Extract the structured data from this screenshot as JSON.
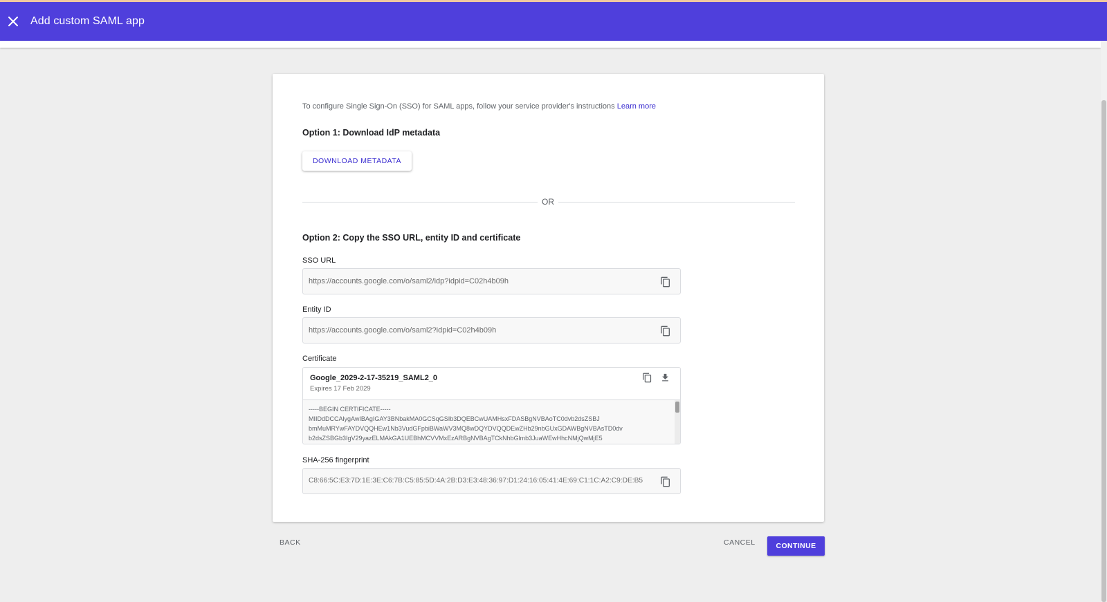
{
  "appbar": {
    "title": "Add custom SAML app"
  },
  "intro": {
    "text": "To configure Single Sign-On (SSO) for SAML apps, follow your service provider's instructions",
    "link": "Learn more"
  },
  "option1": {
    "heading": "Option 1: Download IdP metadata",
    "button": "DOWNLOAD METADATA"
  },
  "separator": "OR",
  "option2": {
    "heading": "Option 2: Copy the SSO URL, entity ID and certificate",
    "sso_url": {
      "label": "SSO URL",
      "value": "https://accounts.google.com/o/saml2/idp?idpid=C02h4b09h"
    },
    "entity_id": {
      "label": "Entity ID",
      "value": "https://accounts.google.com/o/saml2?idpid=C02h4b09h"
    },
    "certificate": {
      "label": "Certificate",
      "name": "Google_2029-2-17-35219_SAML2_0",
      "expires": "Expires 17 Feb 2029",
      "lines": [
        "-----BEGIN CERTIFICATE-----",
        "MIIDdDCCAlygAwIBAgIGAY3BNbakMA0GCSqGSIb3DQEBCwUAMHsxFDASBgNVBAoTC0dvb2dsZSBJ",
        "bmMuMRYwFAYDVQQHEw1Nb3VudGFpbiBWaWV3MQ8wDQYDVQQDEwZHb29nbGUxGDAWBgNVBAsTD0dv",
        "b2dsZSBGb3IgV29yazELMAkGA1UEBhMCVVMxEzARBgNVBAgTCkNhbGlmb3JuaWEwHhcNMjQwMjE5"
      ]
    },
    "fingerprint": {
      "label": "SHA-256 fingerprint",
      "value": "C8:66:5C:E3:7D:1E:3E:C6:7B:C5:85:5D:4A:2B:D3:E3:48:36:97:D1:24:16:05:41:4E:69:C1:1C:A2:C9:DE:B5"
    }
  },
  "footer": {
    "back": "BACK",
    "cancel": "CANCEL",
    "continue": "CONTINUE"
  },
  "colors": {
    "primary": "#4f3fdc",
    "link": "#3b2ed0"
  },
  "icons": {
    "close": "close-icon",
    "copy": "copy-icon",
    "download": "download-icon"
  }
}
